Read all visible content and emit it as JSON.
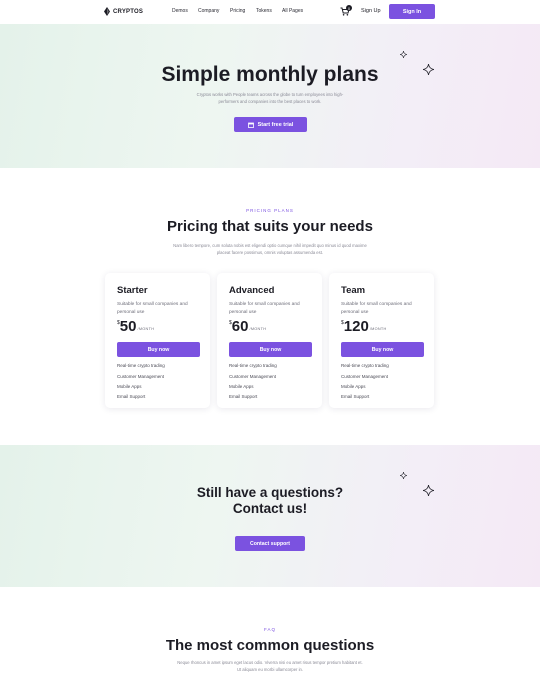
{
  "nav": {
    "brand": "CRYPTOS",
    "menu": [
      "Demos",
      "Company",
      "Pricing",
      "Tokens",
      "All Pages"
    ],
    "cart_count": "0",
    "signup": "Sign Up",
    "signin": "Sign In"
  },
  "hero": {
    "title": "Simple monthly plans",
    "subtitle": "Cryptos works with People teams across the globe to turn employees into high-performers and companies into the best places to work.",
    "cta": "Start free trial"
  },
  "pricing": {
    "eyebrow": "PRICING PLANS",
    "title": "Pricing that suits your needs",
    "subtitle": "Nam libero tempore, cum soluta nobis est eligendi optio cumque nihil impedit quo minus id quod maxime placeat facere possimus, omnis voluptas assumenda est.",
    "plans": [
      {
        "name": "Starter",
        "desc": "Suitable for small companies and personal use",
        "currency": "$",
        "price": "50",
        "period": "/MONTH",
        "cta": "Buy now",
        "features": [
          "Real-time crypto trading",
          "Customer Management",
          "Mobile Apps",
          "Email Support"
        ]
      },
      {
        "name": "Advanced",
        "desc": "Suitable for small companies and personal use",
        "currency": "$",
        "price": "60",
        "period": "/MONTH",
        "cta": "Buy now",
        "features": [
          "Real-time crypto trading",
          "Customer Management",
          "Mobile Apps",
          "Email Support"
        ]
      },
      {
        "name": "Team",
        "desc": "Suitable for small companies and personal use",
        "currency": "$",
        "price": "120",
        "period": "/MONTH",
        "cta": "Buy now",
        "features": [
          "Real-time crypto trading",
          "Customer Management",
          "Mobile Apps",
          "Email Support"
        ]
      }
    ]
  },
  "contact": {
    "title_line1": "Still have a questions?",
    "title_line2": "Contact us!",
    "cta": "Contact support"
  },
  "faq": {
    "eyebrow": "FAQ",
    "title": "The most common questions",
    "subtitle": "Neque rhoncus in amet ipsum eget lacus odio. Viverra nisi eu amet risus tempor pretium habitant et. Ut aliquam eu morbi ullamcorper in."
  },
  "colors": {
    "accent": "#7b52e0",
    "text": "#1c1c24",
    "muted": "#8a8a96"
  }
}
